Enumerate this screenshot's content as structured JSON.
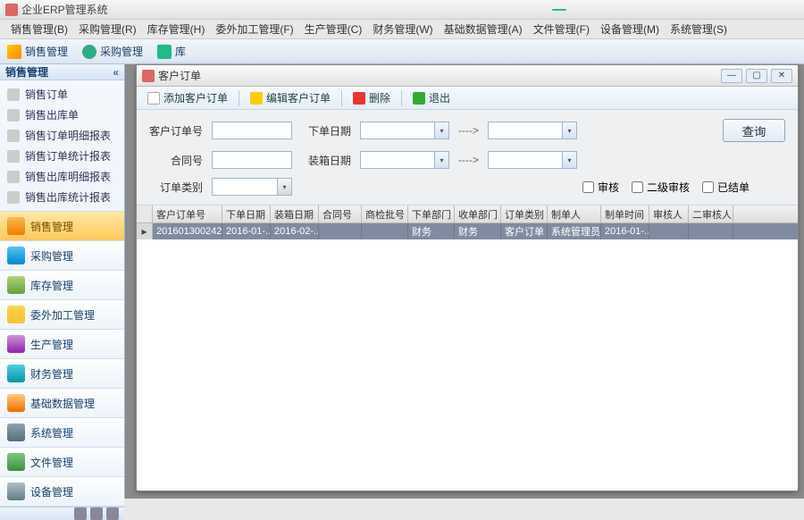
{
  "app": {
    "title": "企业ERP管理系统",
    "badge": ""
  },
  "menu": {
    "items": [
      "销售管理(B)",
      "采购管理(R)",
      "库存管理(H)",
      "委外加工管理(F)",
      "生产管理(C)",
      "财务管理(W)",
      "基础数据管理(A)",
      "文件管理(F)",
      "设备管理(M)",
      "系统管理(S)"
    ]
  },
  "toolstrip": {
    "sale": "销售管理",
    "buy": "采购管理",
    "stock": "库"
  },
  "sidebar": {
    "header": "销售管理",
    "chevron": "«",
    "tree": [
      "销售订单",
      "销售出库单",
      "销售订单明细报表",
      "销售订单统计报表",
      "销售出库明细报表",
      "销售出库统计报表"
    ],
    "modules": [
      "销售管理",
      "采购管理",
      "库存管理",
      "委外加工管理",
      "生产管理",
      "财务管理",
      "基础数据管理",
      "系统管理",
      "文件管理",
      "设备管理"
    ]
  },
  "mdi": {
    "caption": "客户订单",
    "toolbar": {
      "add": "添加客户订单",
      "edit": "编辑客户订单",
      "del": "删除",
      "exit": "退出"
    },
    "form": {
      "labels": {
        "orderNo": "客户订单号",
        "contractNo": "合同号",
        "orderType": "订单类别",
        "orderDate": "下单日期",
        "packDate": "装箱日期"
      },
      "arrow": "---->",
      "searchBtn": "查询",
      "checks": {
        "audit": "审核",
        "audit2": "二级审核",
        "closed": "已结单"
      }
    },
    "grid": {
      "cols": [
        "客户订单号",
        "下单日期",
        "装箱日期",
        "合同号",
        "商检批号",
        "下单部门",
        "收单部门",
        "订单类别",
        "制单人",
        "制单时间",
        "审核人",
        "二审核人"
      ],
      "rows": [
        {
          "orderNo": "201601300242",
          "orderDate": "2016-01-...",
          "packDate": "2016-02-...",
          "contractNo": "",
          "inspectNo": "",
          "orderDept": "财务",
          "recvDept": "财务",
          "orderType": "客户订单",
          "maker": "系统管理员",
          "makeTime": "2016-01-...",
          "auditor": "",
          "auditor2": ""
        }
      ]
    }
  }
}
